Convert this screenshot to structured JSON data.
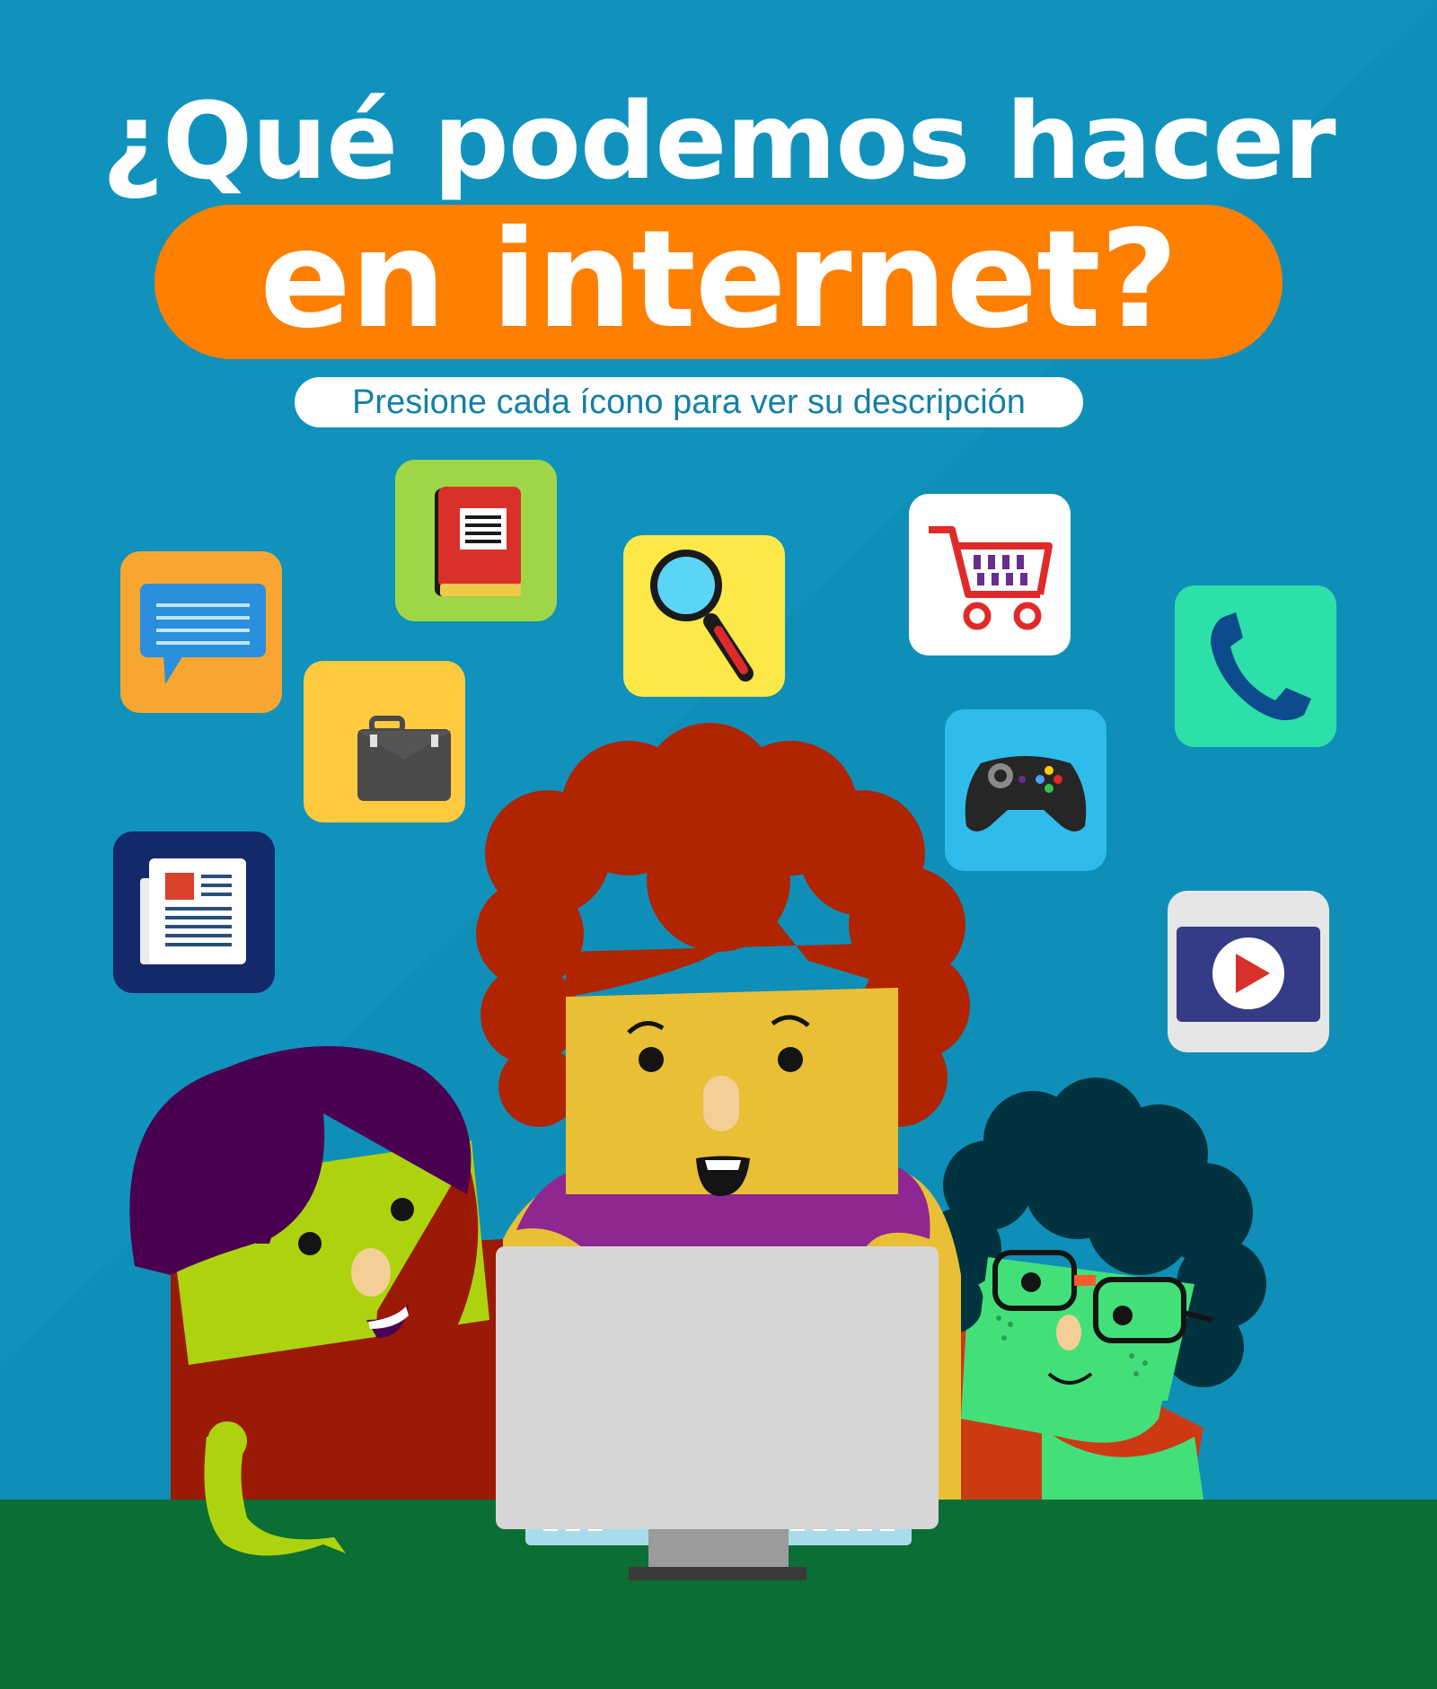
{
  "header": {
    "title_line1": "¿Qué podemos hacer",
    "title_line2": "en internet?",
    "subtitle": "Presione cada ícono para ver su descripción"
  },
  "icons": [
    {
      "name": "chat-icon",
      "color": "#f7a731"
    },
    {
      "name": "book-icon",
      "color": "#9ed648"
    },
    {
      "name": "search-icon",
      "color": "#fde84a"
    },
    {
      "name": "shopping-cart-icon",
      "color": "#ffffff"
    },
    {
      "name": "phone-icon",
      "color": "#2ddfa8"
    },
    {
      "name": "briefcase-icon",
      "color": "#ffca40"
    },
    {
      "name": "gamepad-icon",
      "color": "#2fbcea"
    },
    {
      "name": "newspaper-icon",
      "color": "#14296a"
    },
    {
      "name": "video-play-icon",
      "color": "#e6e6e6"
    }
  ],
  "colors": {
    "background": "#0f8fb8",
    "accent": "#ff7f00",
    "floor": "#0b6e35",
    "monitor": "#d6d6d6"
  }
}
